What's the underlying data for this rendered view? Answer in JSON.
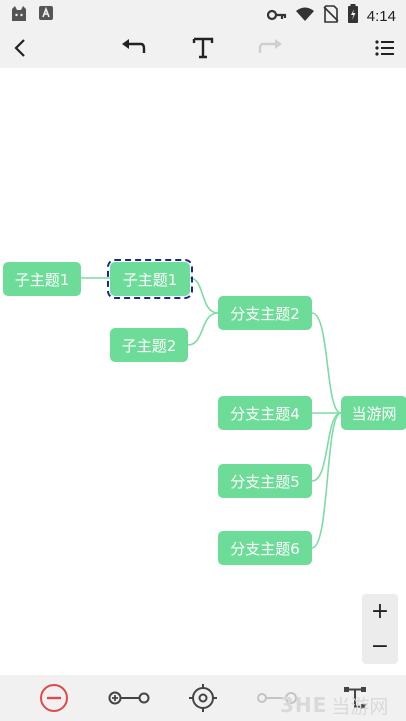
{
  "status_bar": {
    "time": "4:14",
    "icons": [
      "cat-app-icon",
      "text-app-icon",
      "vpn-key-icon",
      "wifi-icon",
      "no-sim-icon",
      "battery-icon"
    ]
  },
  "toolbar": {
    "icons": [
      "back-icon",
      "undo-icon",
      "text-icon",
      "redo-icon",
      "list-icon"
    ]
  },
  "mindmap": {
    "root": "当游网",
    "branches": [
      "分支主题2",
      "分支主题4",
      "分支主题5",
      "分支主题6"
    ],
    "subtopics": [
      "子主题1",
      "子主题2"
    ],
    "sub_subtopic": "子主题1",
    "selected_node": "子主题1",
    "node_color": "#6ddc98",
    "link_color": "#7ddca4"
  },
  "zoom": {
    "zoom_in": "+",
    "zoom_out": "−"
  },
  "bottom_bar": {
    "icons": [
      "remove-node-icon",
      "connect-icon",
      "center-icon",
      "link-icon",
      "structure-icon"
    ],
    "accent_remove": "#e0494c"
  },
  "watermark": {
    "logo": "3HE",
    "text": "当游网"
  }
}
